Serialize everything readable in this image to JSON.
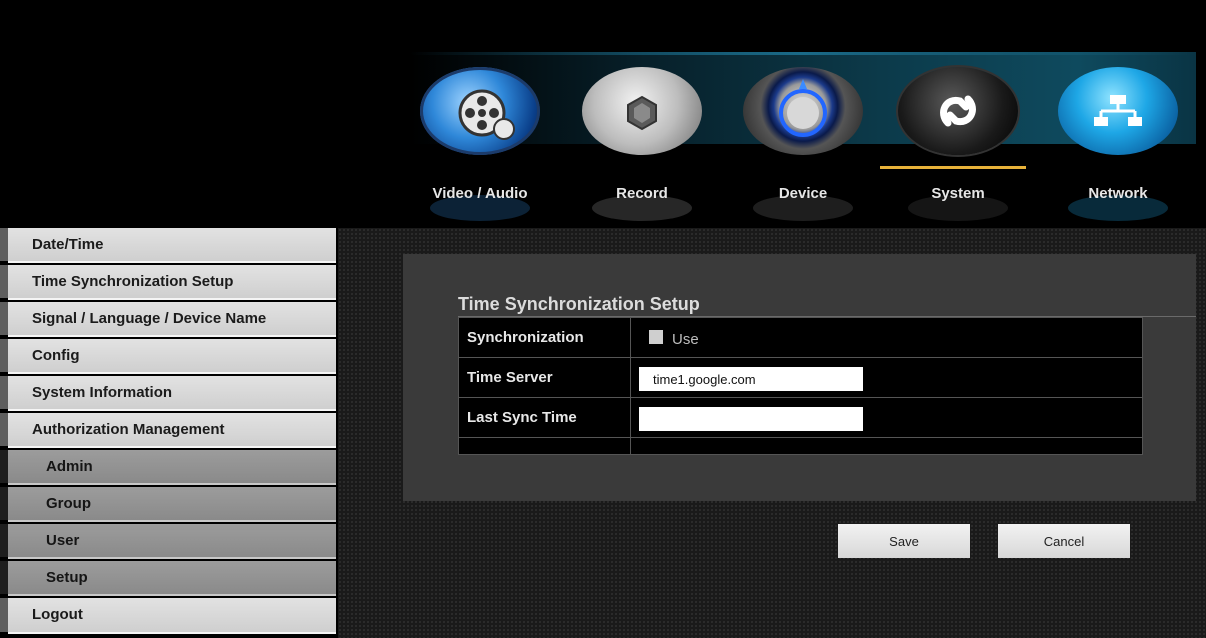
{
  "nav": {
    "tabs": [
      {
        "label": "Video / Audio",
        "icon": "film-reel-speaker-icon"
      },
      {
        "label": "Record",
        "icon": "camera-shutter-icon"
      },
      {
        "label": "Device",
        "icon": "gear-dial-icon"
      },
      {
        "label": "System",
        "icon": "system-swirl-icon"
      },
      {
        "label": "Network",
        "icon": "network-hierarchy-icon"
      }
    ],
    "active": "System",
    "accent_color": "#e8b23a"
  },
  "sidebar": {
    "items": [
      {
        "label": "Date/Time"
      },
      {
        "label": "Time Synchronization Setup"
      },
      {
        "label": "Signal / Language / Device Name"
      },
      {
        "label": "Config"
      },
      {
        "label": "System Information"
      },
      {
        "label": "Authorization Management"
      }
    ],
    "sub_items": [
      {
        "label": "Admin"
      },
      {
        "label": "Group"
      },
      {
        "label": "User"
      },
      {
        "label": "Setup"
      }
    ],
    "logout_label": "Logout"
  },
  "main": {
    "title": "Time Synchronization Setup",
    "fields": {
      "synchronization": {
        "label": "Synchronization",
        "checkbox_label": "Use",
        "checked": false
      },
      "time_server": {
        "label": "Time Server",
        "value": "time1.google.com"
      },
      "last_sync_time": {
        "label": "Last Sync Time",
        "value": ""
      }
    },
    "save_label": "Save",
    "cancel_label": "Cancel"
  }
}
